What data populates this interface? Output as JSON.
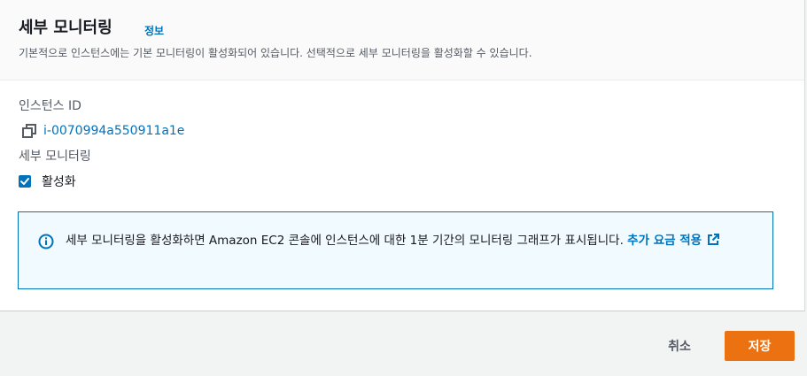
{
  "panel": {
    "title": "세부 모니터링",
    "info_link": "정보",
    "description": "기본적으로 인스턴스에는 기본 모니터링이 활성화되어 있습니다. 선택적으로 세부 모니터링을 활성화할 수 있습니다."
  },
  "instance": {
    "label": "인스턴스 ID",
    "id": "i-0070994a550911a1e",
    "copy_icon": "copy-icon"
  },
  "monitoring": {
    "label": "세부 모니터링",
    "checkbox_label": "활성화",
    "checked": true
  },
  "alert": {
    "icon": "info-icon",
    "text": "세부 모니터링을 활성화하면 Amazon EC2 콘솔에 인스턴스에 대한 1분 기간의 모니터링 그래프가 표시됩니다. ",
    "link_text": "추가 요금 적용",
    "link_icon": "external-link-icon"
  },
  "actions": {
    "cancel": "취소",
    "save": "저장"
  },
  "colors": {
    "link": "#0073bb",
    "primary_button": "#ec7211",
    "alert_background": "#f1faff"
  }
}
